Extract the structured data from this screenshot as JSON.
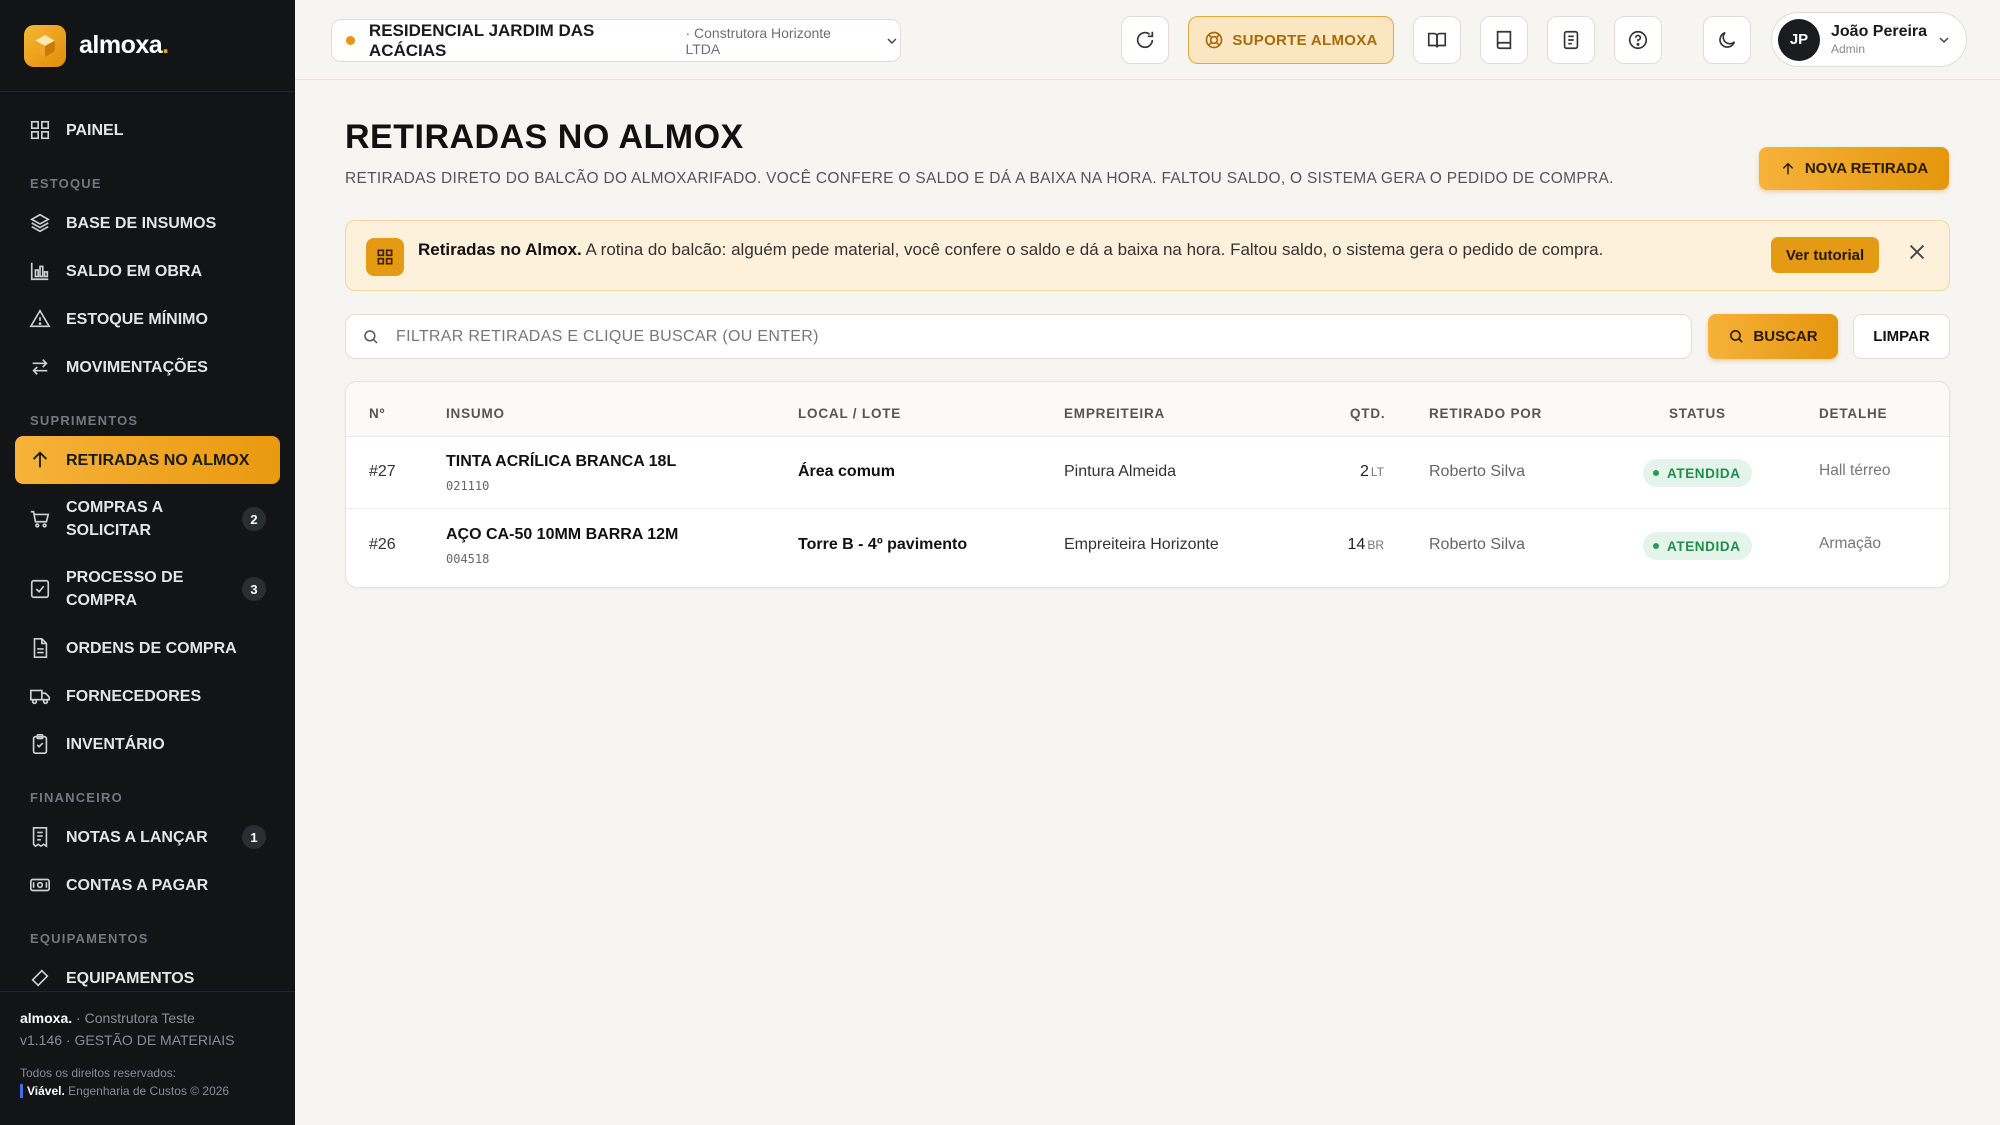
{
  "brand": {
    "name": "almoxa",
    "dot": "."
  },
  "sidebar": {
    "items": [
      {
        "label": "PAINEL"
      },
      {
        "section": "ESTOQUE"
      },
      {
        "label": "BASE DE INSUMOS"
      },
      {
        "label": "SALDO EM OBRA"
      },
      {
        "label": "ESTOQUE MÍNIMO"
      },
      {
        "label": "MOVIMENTAÇÕES"
      },
      {
        "section": "SUPRIMENTOS"
      },
      {
        "label": "RETIRADAS NO ALMOX",
        "active": true
      },
      {
        "label": "COMPRAS A SOLICITAR",
        "count": "2"
      },
      {
        "label": "PROCESSO DE COMPRA",
        "count": "3"
      },
      {
        "label": "ORDENS DE COMPRA"
      },
      {
        "label": "FORNECEDORES"
      },
      {
        "label": "INVENTÁRIO"
      },
      {
        "section": "FINANCEIRO"
      },
      {
        "label": "NOTAS A LANÇAR",
        "count": "1"
      },
      {
        "label": "CONTAS A PAGAR"
      },
      {
        "section": "EQUIPAMENTOS"
      },
      {
        "label": "EQUIPAMENTOS"
      }
    ],
    "footer": {
      "brand": "almoxa.",
      "company": "· Construtora Teste",
      "version": "v1.146 · GESTÃO DE MATERIAIS",
      "rights": "Todos os direitos reservados:",
      "credit_brand": "Viável.",
      "credit_text": " Engenharia de Custos © 2026"
    }
  },
  "header": {
    "project_name": "RESIDENCIAL JARDIM DAS ACÁCIAS",
    "project_company": "· Construtora Horizonte LTDA",
    "support_label": "SUPORTE ALMOXA",
    "user_initials": "JP",
    "user_name": "João Pereira",
    "user_role": "Admin"
  },
  "page": {
    "title": "RETIRADAS NO ALMOX",
    "subtitle": "RETIRADAS DIRETO DO BALCÃO DO ALMOXARIFADO. VOCÊ CONFERE O SALDO E DÁ A BAIXA NA HORA. FALTOU SALDO, O SISTEMA GERA O PEDIDO DE COMPRA.",
    "new_button": "NOVA RETIRADA"
  },
  "banner": {
    "title": "Retiradas no Almox.",
    "text": " A rotina do balcão: alguém pede material, você confere o saldo e dá a baixa na hora. Faltou saldo, o sistema gera o pedido de compra.",
    "tutorial_button": "Ver tutorial"
  },
  "search": {
    "placeholder": "FILTRAR RETIRADAS E CLIQUE BUSCAR (OU ENTER)",
    "search_button": "BUSCAR",
    "clear_button": "LIMPAR"
  },
  "table": {
    "headers": {
      "num": "Nº",
      "insumo": "INSUMO",
      "local": "LOCAL / LOTE",
      "empreiteira": "EMPREITEIRA",
      "qtd": "QTD.",
      "retirado_por": "RETIRADO POR",
      "status": "STATUS",
      "detalhe": "DETALHE"
    },
    "rows": [
      {
        "num": "#27",
        "insumo": "TINTA ACRÍLICA BRANCA 18L",
        "code": "021110",
        "local": "Área comum",
        "empreiteira": "Pintura Almeida",
        "qtd": "2",
        "unit": "LT",
        "retirado_por": "Roberto Silva",
        "status": "ATENDIDA",
        "detalhe": "Hall térreo"
      },
      {
        "num": "#26",
        "insumo": "AÇO CA-50 10MM BARRA 12M",
        "code": "004518",
        "local": "Torre B - 4º pavimento",
        "empreiteira": "Empreiteira Horizonte",
        "qtd": "14",
        "unit": "BR",
        "retirado_por": "Roberto Silva",
        "status": "ATENDIDA",
        "detalhe": "Armação"
      }
    ]
  },
  "colors": {
    "accent": "#e9990f",
    "sidebar": "#121416",
    "status_green": "#1f8d4a"
  }
}
